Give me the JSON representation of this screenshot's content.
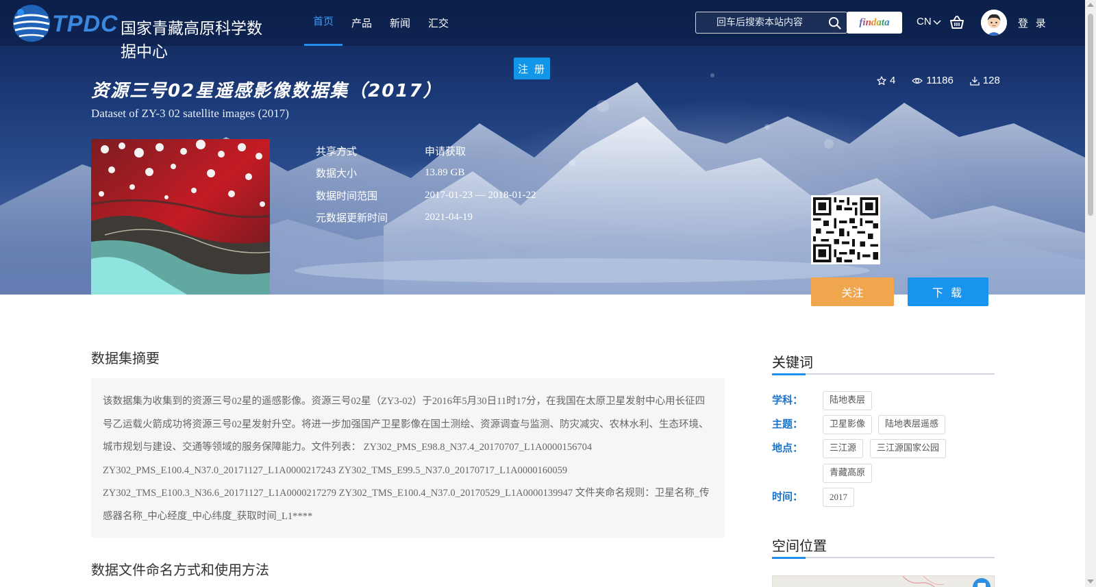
{
  "header": {
    "logo_latin": "TPDC",
    "logo_name": "国家青藏高原科学数据中心",
    "nav": [
      {
        "label": "首页",
        "active": true
      },
      {
        "label": "产品",
        "active": false
      },
      {
        "label": "新闻",
        "active": false
      },
      {
        "label": "汇交",
        "active": false
      }
    ],
    "search_placeholder": "回车后搜索本站内容",
    "findata_label": "findata",
    "lang_label": "CN",
    "login_label": "登 录",
    "register_label": "注 册"
  },
  "dataset": {
    "title": "资源三号02星遥感影像数据集（2017）",
    "subtitle": "Dataset of ZY-3 02 satellite images (2017)",
    "stats": {
      "favorites": "4",
      "views": "11186",
      "downloads": "128"
    },
    "meta": [
      {
        "label": "共享方式",
        "value": "申请获取"
      },
      {
        "label": "数据大小",
        "value": "13.89 GB"
      },
      {
        "label": "数据时间范围",
        "value": "2017-01-23 — 2018-01-22"
      },
      {
        "label": "元数据更新时间",
        "value": "2021-04-19"
      }
    ],
    "follow_label": "关注",
    "download_label": "下 载"
  },
  "abstract": {
    "title": "数据集摘要",
    "text": "该数据集为收集到的资源三号02星的遥感影像。资源三号02星（ZY3-02）于2016年5月30日11时17分，在我国在太原卫星发射中心用长征四号乙运载火箭成功将资源三号02星发射升空。将进一步加强国产卫星影像在国土测绘、资源调查与监测、防灾减灾、农林水利、生态环境、城市规划与建设、交通等领域的服务保障能力。文件列表： ZY302_PMS_E98.8_N37.4_20170707_L1A0000156704 ZY302_PMS_E100.4_N37.0_20171127_L1A0000217243 ZY302_TMS_E99.5_N37.0_20170717_L1A0000160059 ZY302_TMS_E100.3_N36.6_20171127_L1A0000217279 ZY302_TMS_E100.4_N37.0_20170529_L1A0000139947 文件夹命名规则：卫星名称_传感器名称_中心经度_中心纬度_获取时间_L1****"
  },
  "naming_section_title": "数据文件命名方式和使用方法",
  "keywords": {
    "title": "关键词",
    "subject_label": "学科：",
    "subject_tags": [
      "陆地表层"
    ],
    "theme_label": "主题：",
    "theme_tags": [
      "卫星影像",
      "陆地表层遥感"
    ],
    "place_label": "地点：",
    "place_tags": [
      "三江源",
      "三江源国家公园",
      "青藏高原"
    ],
    "time_label": "时间：",
    "time_tags": [
      "2017"
    ]
  },
  "spatial": {
    "title": "空间位置"
  },
  "colors": {
    "primary_blue": "#1994ee",
    "follow_orange": "#f0a64c",
    "keyword_label_blue": "#1a73c9"
  }
}
